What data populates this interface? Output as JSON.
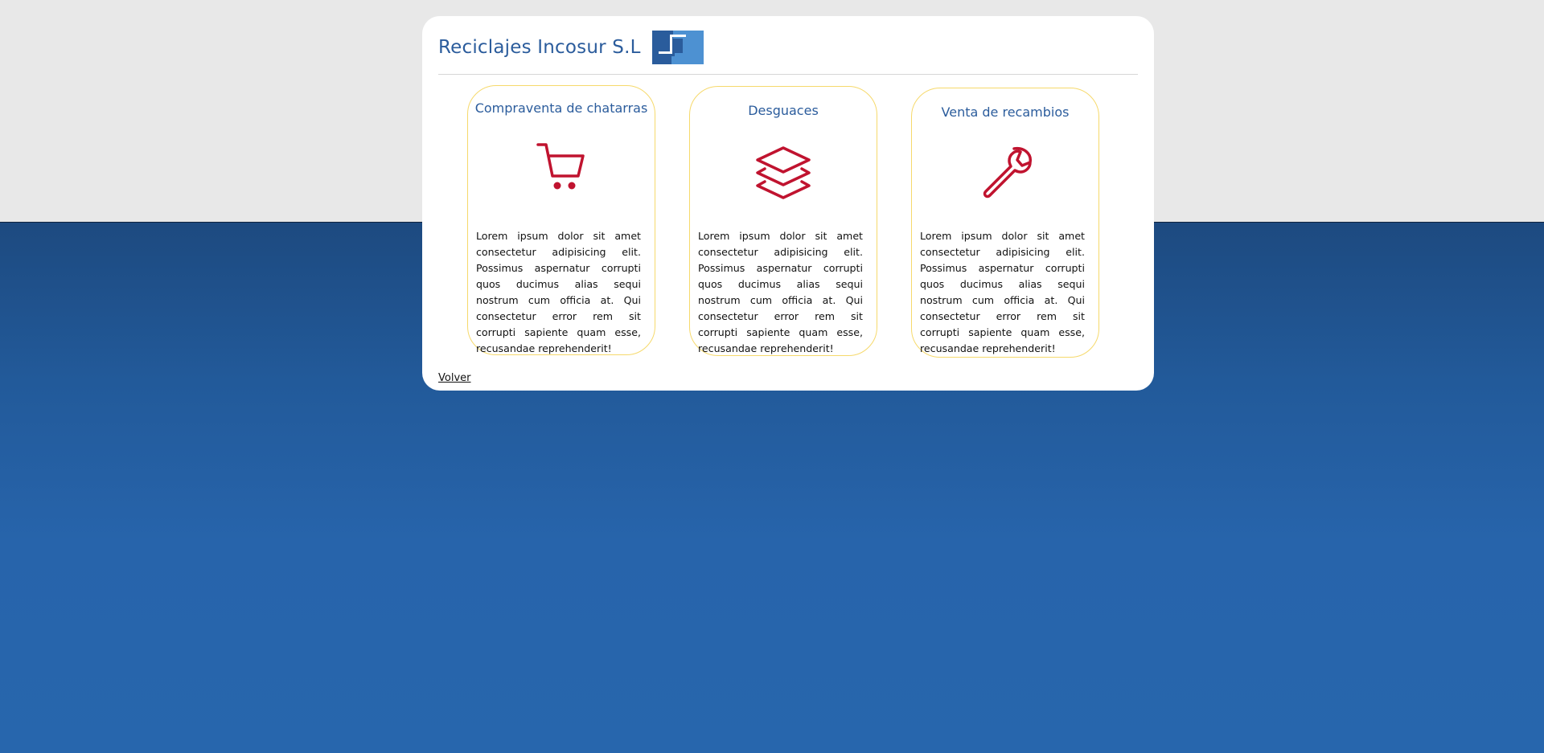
{
  "header": {
    "title": "Reciclajes Incosur S.L"
  },
  "colors": {
    "brand_blue": "#2b5c9c",
    "logo_dark": "#2a5c9c",
    "logo_light": "#4d91d2",
    "icon_red": "#c0132f",
    "card_border": "#f6d96b"
  },
  "services": [
    {
      "title": "Compraventa de chatarras",
      "icon": "shopping-cart-icon",
      "description": "Lorem ipsum dolor sit amet consectetur adipisicing elit. Possimus aspernatur corrupti quos ducimus alias sequi nostrum cum officia at. Qui consectetur error rem sit corrupti sapiente quam esse, recusandae reprehenderit!"
    },
    {
      "title": "Desguaces",
      "icon": "layers-icon",
      "description": "Lorem ipsum dolor sit amet consectetur adipisicing elit. Possimus aspernatur corrupti quos ducimus alias sequi nostrum cum officia at. Qui consectetur error rem sit corrupti sapiente quam esse, recusandae reprehenderit!"
    },
    {
      "title": "Venta de recambios",
      "icon": "wrench-icon",
      "description": "Lorem ipsum dolor sit amet consectetur adipisicing elit. Possimus aspernatur corrupti quos ducimus alias sequi nostrum cum officia at. Qui consectetur error rem sit corrupti sapiente quam esse, recusandae reprehenderit!"
    }
  ],
  "footer": {
    "back_label": "Volver"
  }
}
